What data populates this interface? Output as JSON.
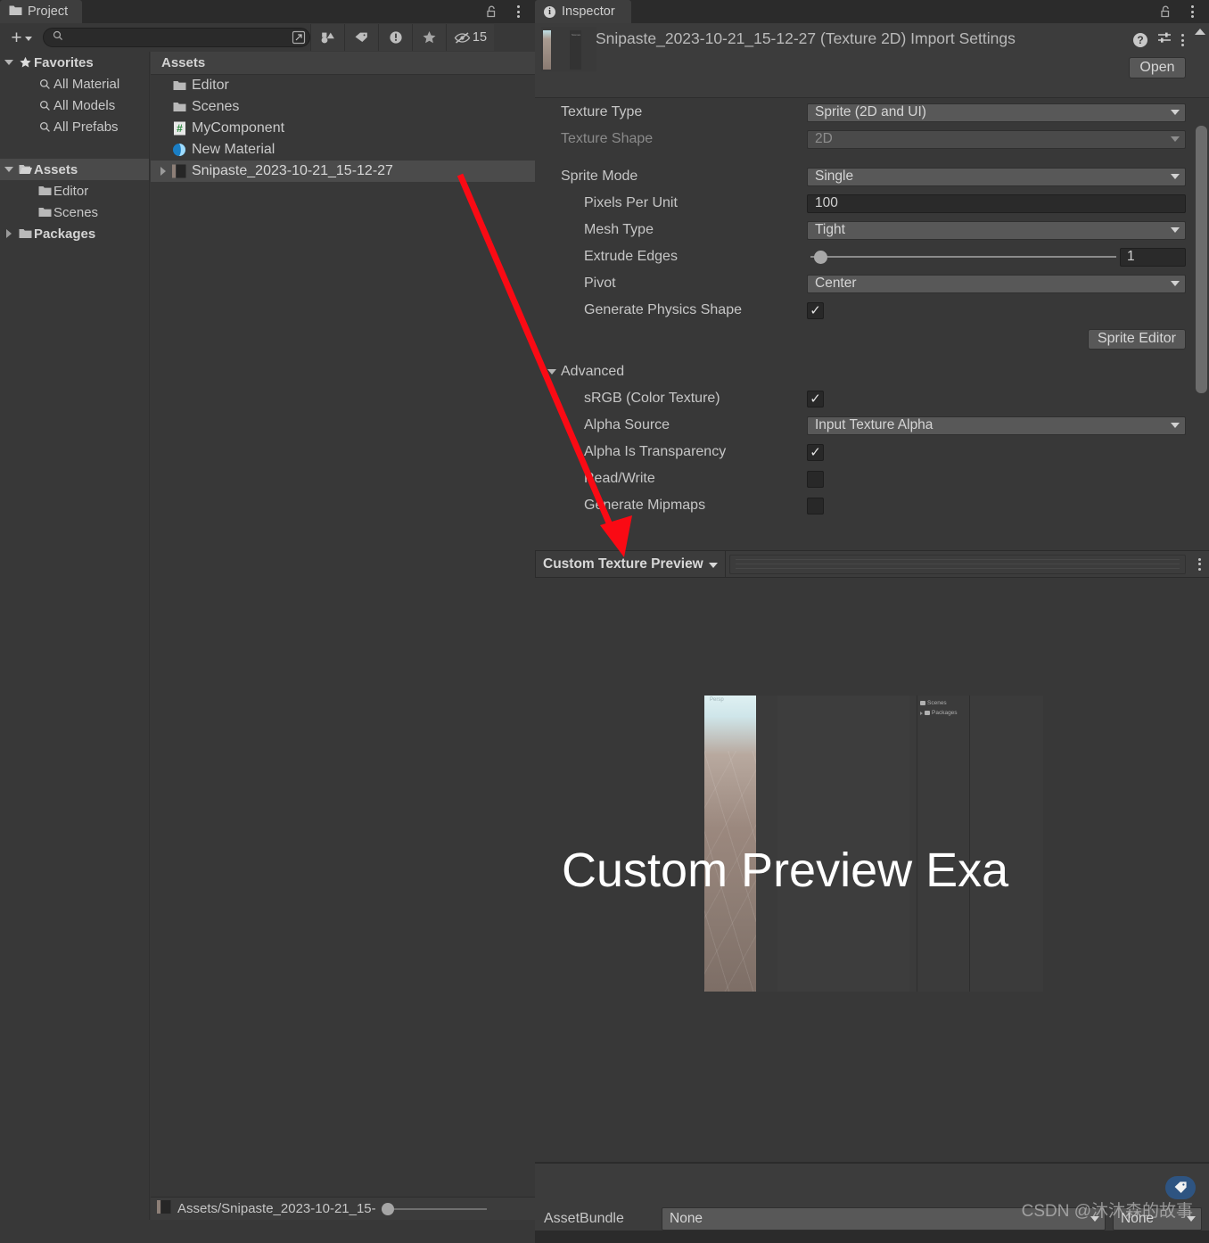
{
  "project": {
    "tab_label": "Project",
    "tab_icon": "folder-icon",
    "lock_icon": "lock-open-icon",
    "menu_icon": "kebab-menu-icon",
    "toolbar": {
      "add_label": "+",
      "search_placeholder": "",
      "search_value": "",
      "search_icon": "search-icon",
      "open_in_new_icon": "open-in-new-icon",
      "filter_type_icon": "filter-by-type-icon",
      "filter_label_icon": "filter-by-label-icon",
      "filter_issue_icon": "filter-by-issue-icon",
      "filter_star_icon": "filter-favorite-icon",
      "hidden_icon": "hidden-count-icon",
      "hidden_count": "15"
    },
    "tree": [
      {
        "label": "Favorites",
        "icon": "star-icon",
        "depth": 0,
        "twisty": "down",
        "bold": true,
        "selected": false
      },
      {
        "label": "All Material",
        "icon": "search-icon",
        "depth": 1,
        "twisty": "none",
        "bold": false,
        "selected": false
      },
      {
        "label": "All Models",
        "icon": "search-icon",
        "depth": 1,
        "twisty": "none",
        "bold": false,
        "selected": false
      },
      {
        "label": "All Prefabs",
        "icon": "search-icon",
        "depth": 1,
        "twisty": "none",
        "bold": false,
        "selected": false
      },
      {
        "label": "",
        "icon": "spacer",
        "depth": 0,
        "twisty": "none",
        "bold": false,
        "selected": false
      },
      {
        "label": "Assets",
        "icon": "folder-open-icon",
        "depth": 0,
        "twisty": "down",
        "bold": true,
        "selected": true
      },
      {
        "label": "Editor",
        "icon": "folder-icon",
        "depth": 1,
        "twisty": "none",
        "bold": false,
        "selected": false
      },
      {
        "label": "Scenes",
        "icon": "folder-icon",
        "depth": 1,
        "twisty": "none",
        "bold": false,
        "selected": false
      },
      {
        "label": "Packages",
        "icon": "folder-icon",
        "depth": 0,
        "twisty": "right",
        "bold": true,
        "selected": false
      }
    ],
    "list_header": "Assets",
    "list": [
      {
        "label": "Editor",
        "icon": "folder-icon",
        "twisty": "none",
        "selected": false
      },
      {
        "label": "Scenes",
        "icon": "folder-icon",
        "twisty": "none",
        "selected": false
      },
      {
        "label": "MyComponent",
        "icon": "csharp-script-icon",
        "twisty": "none",
        "selected": false
      },
      {
        "label": "New Material",
        "icon": "material-icon",
        "twisty": "none",
        "selected": false
      },
      {
        "label": "Snipaste_2023-10-21_15-12-27",
        "icon": "texture-icon",
        "twisty": "right",
        "selected": true
      }
    ],
    "status_path": "Assets/Snipaste_2023-10-21_15-",
    "status_icon": "texture-icon",
    "zoom_value": 0
  },
  "inspector": {
    "tab_label": "Inspector",
    "tab_icon": "info-icon",
    "lock_icon": "lock-open-icon",
    "menu_icon": "kebab-menu-icon",
    "header": {
      "title": "Snipaste_2023-10-21_15-12-27 (Texture 2D) Import Settings",
      "thumb_icon": "texture-thumbnail",
      "help_icon": "help-icon",
      "preset_icon": "preset-icon",
      "kebab_icon": "kebab-menu-icon",
      "open_button": "Open"
    },
    "fields": [
      {
        "name": "texture-type",
        "label": "Texture Type",
        "control": "dropdown",
        "value": "Sprite (2D and UI)",
        "disabled": false,
        "indent": 0
      },
      {
        "name": "texture-shape",
        "label": "Texture Shape",
        "control": "dropdown",
        "value": "2D",
        "disabled": true,
        "indent": 0
      },
      {
        "name": "sprite-mode",
        "label": "Sprite Mode",
        "control": "dropdown",
        "value": "Single",
        "disabled": false,
        "indent": 0
      },
      {
        "name": "pixels-per-unit",
        "label": "Pixels Per Unit",
        "control": "text",
        "value": "100",
        "disabled": false,
        "indent": 1
      },
      {
        "name": "mesh-type",
        "label": "Mesh Type",
        "control": "dropdown",
        "value": "Tight",
        "disabled": false,
        "indent": 1
      },
      {
        "name": "extrude-edges",
        "label": "Extrude Edges",
        "control": "slider",
        "value": "1",
        "disabled": false,
        "indent": 1
      },
      {
        "name": "pivot",
        "label": "Pivot",
        "control": "dropdown",
        "value": "Center",
        "disabled": false,
        "indent": 1
      },
      {
        "name": "generate-physics-shape",
        "label": "Generate Physics Shape",
        "control": "checkbox",
        "value": "checked",
        "disabled": false,
        "indent": 1
      }
    ],
    "sprite_editor_button": "Sprite Editor",
    "advanced": {
      "label": "Advanced",
      "expanded": true,
      "fields": [
        {
          "name": "srgb-color-texture",
          "label": "sRGB (Color Texture)",
          "control": "checkbox",
          "value": "checked",
          "indent": 1
        },
        {
          "name": "alpha-source",
          "label": "Alpha Source",
          "control": "dropdown",
          "value": "Input Texture Alpha",
          "indent": 1
        },
        {
          "name": "alpha-is-transparency",
          "label": "Alpha Is Transparency",
          "control": "checkbox",
          "value": "checked",
          "indent": 1
        },
        {
          "name": "read-write",
          "label": "Read/Write",
          "control": "checkbox",
          "value": "unchecked",
          "indent": 1
        },
        {
          "name": "generate-mipmaps",
          "label": "Generate Mipmaps",
          "control": "checkbox",
          "value": "unchecked",
          "indent": 1
        }
      ]
    },
    "preview": {
      "title": "Custom Texture Preview",
      "dropdown_icon": "chevron-down-icon",
      "menu_icon": "kebab-menu-icon",
      "overlay_text": "Custom Preview Exa",
      "inner_persp_label": "Persp",
      "inner_tree": [
        "Scenes",
        "Packages"
      ]
    },
    "footer": {
      "assetbundle_label": "AssetBundle",
      "assetbundle_value": "None",
      "variant_value": "None",
      "tag_icon": "label-tag-icon"
    }
  },
  "annotation": {
    "arrow_color": "#fa0a14",
    "arrow_from": "asset-row",
    "arrow_to": "custom-texture-preview-bar"
  },
  "watermark": "CSDN @沐沐森的故事"
}
